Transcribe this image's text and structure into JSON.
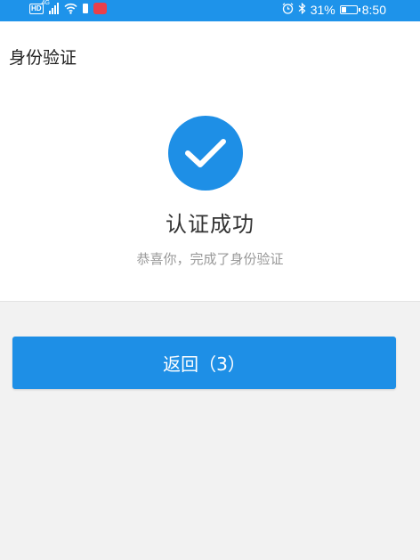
{
  "status_bar": {
    "hd_badge": "HD",
    "network_label": "4G",
    "battery_percent": "31%",
    "battery_level": 0.31,
    "time": "8:50",
    "icons": [
      "hd-icon",
      "signal-icon",
      "wifi-icon",
      "battery-saver-icon",
      "app-notification-icon",
      "alarm-icon",
      "bluetooth-icon",
      "battery-icon"
    ]
  },
  "header": {
    "title": "身份验证"
  },
  "result": {
    "icon": "check-circle-icon",
    "title": "认证成功",
    "description": "恭喜你，完成了身份验证"
  },
  "actions": {
    "back_label": "返回（3）"
  },
  "colors": {
    "status_bar": "#1e93ea",
    "accent": "#1e8fe6",
    "page_background": "#f2f2f2",
    "card_background": "#ffffff"
  }
}
